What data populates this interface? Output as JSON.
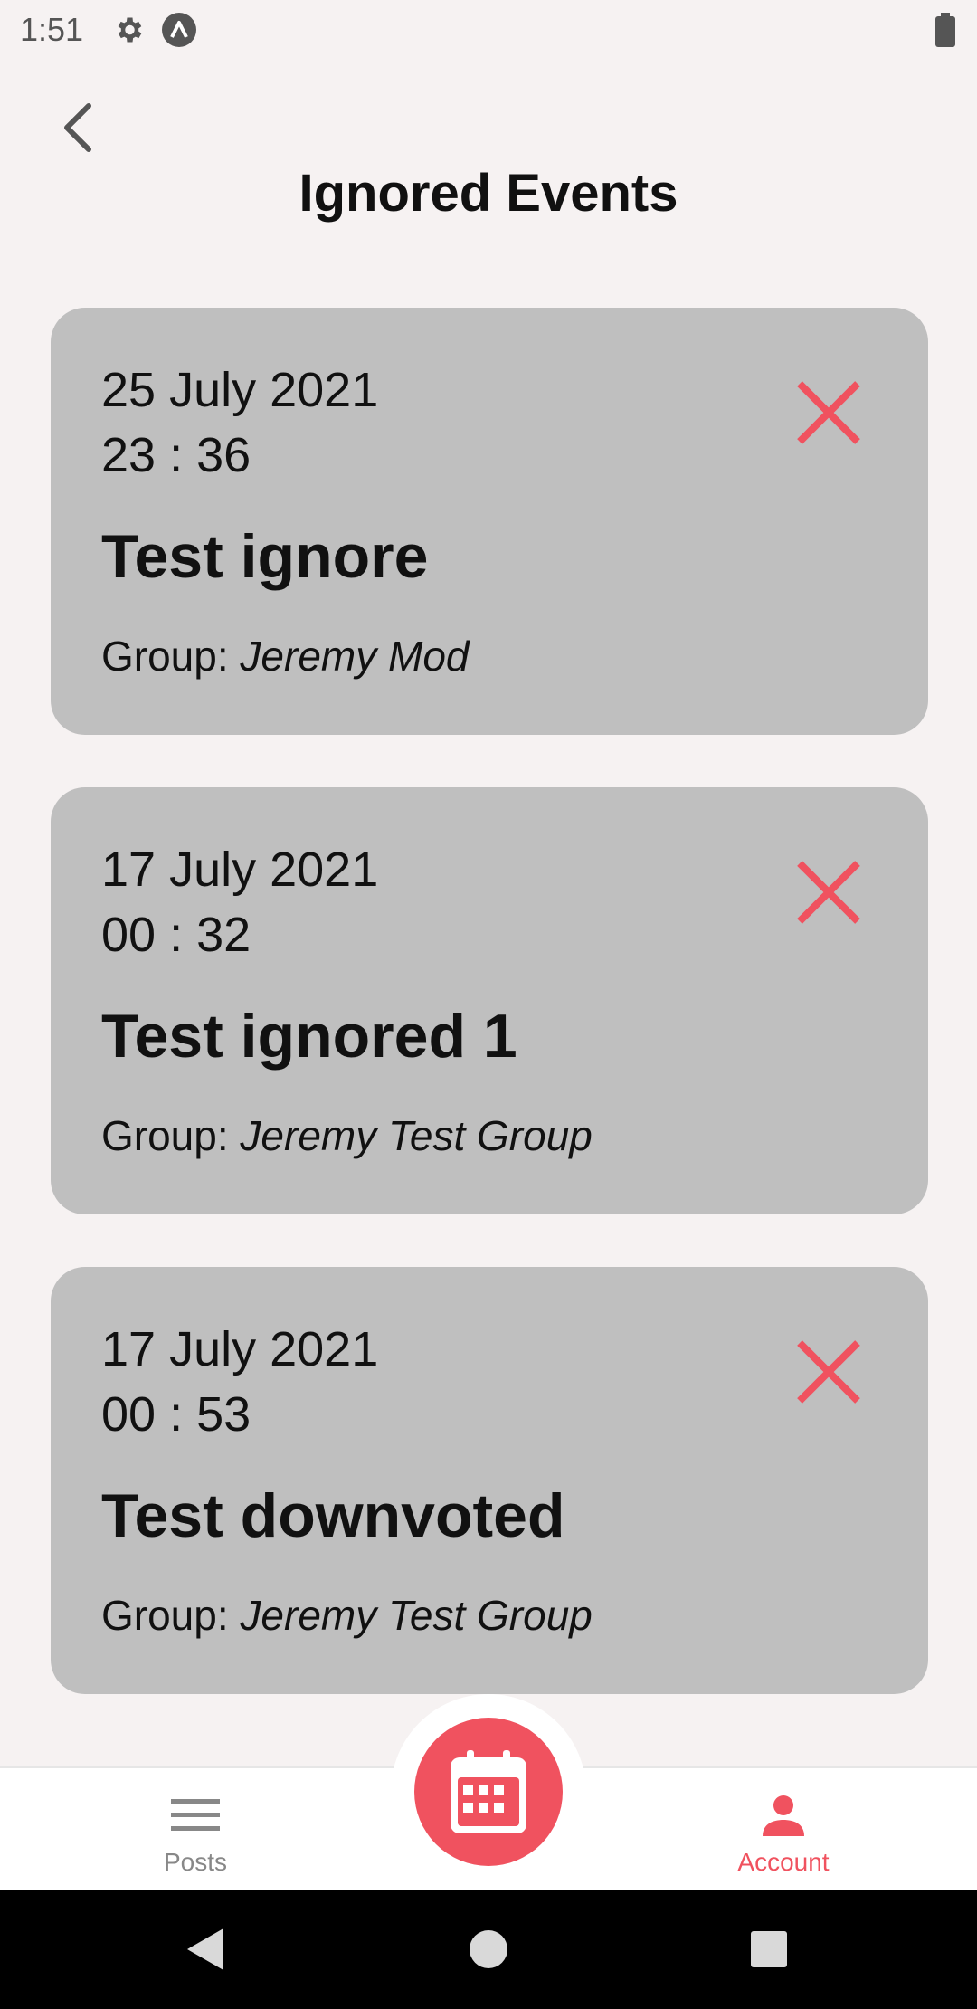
{
  "status_bar": {
    "time": "1:51"
  },
  "header": {
    "title": "Ignored Events"
  },
  "events": [
    {
      "date": "25 July 2021",
      "time": "23 : 36",
      "title": "Test ignore",
      "group_prefix": "Group: ",
      "group": "Jeremy Mod"
    },
    {
      "date": "17 July 2021",
      "time": "00 : 32",
      "title": "Test ignored 1",
      "group_prefix": "Group: ",
      "group": "Jeremy Test Group"
    },
    {
      "date": "17 July 2021",
      "time": "00 : 53",
      "title": "Test downvoted",
      "group_prefix": "Group: ",
      "group": "Jeremy Test Group"
    }
  ],
  "bottom_nav": {
    "posts_label": "Posts",
    "account_label": "Account",
    "active": "Account"
  },
  "colors": {
    "accent": "#f0525f",
    "card": "#bfbfbf",
    "background": "#f6f2f2"
  }
}
